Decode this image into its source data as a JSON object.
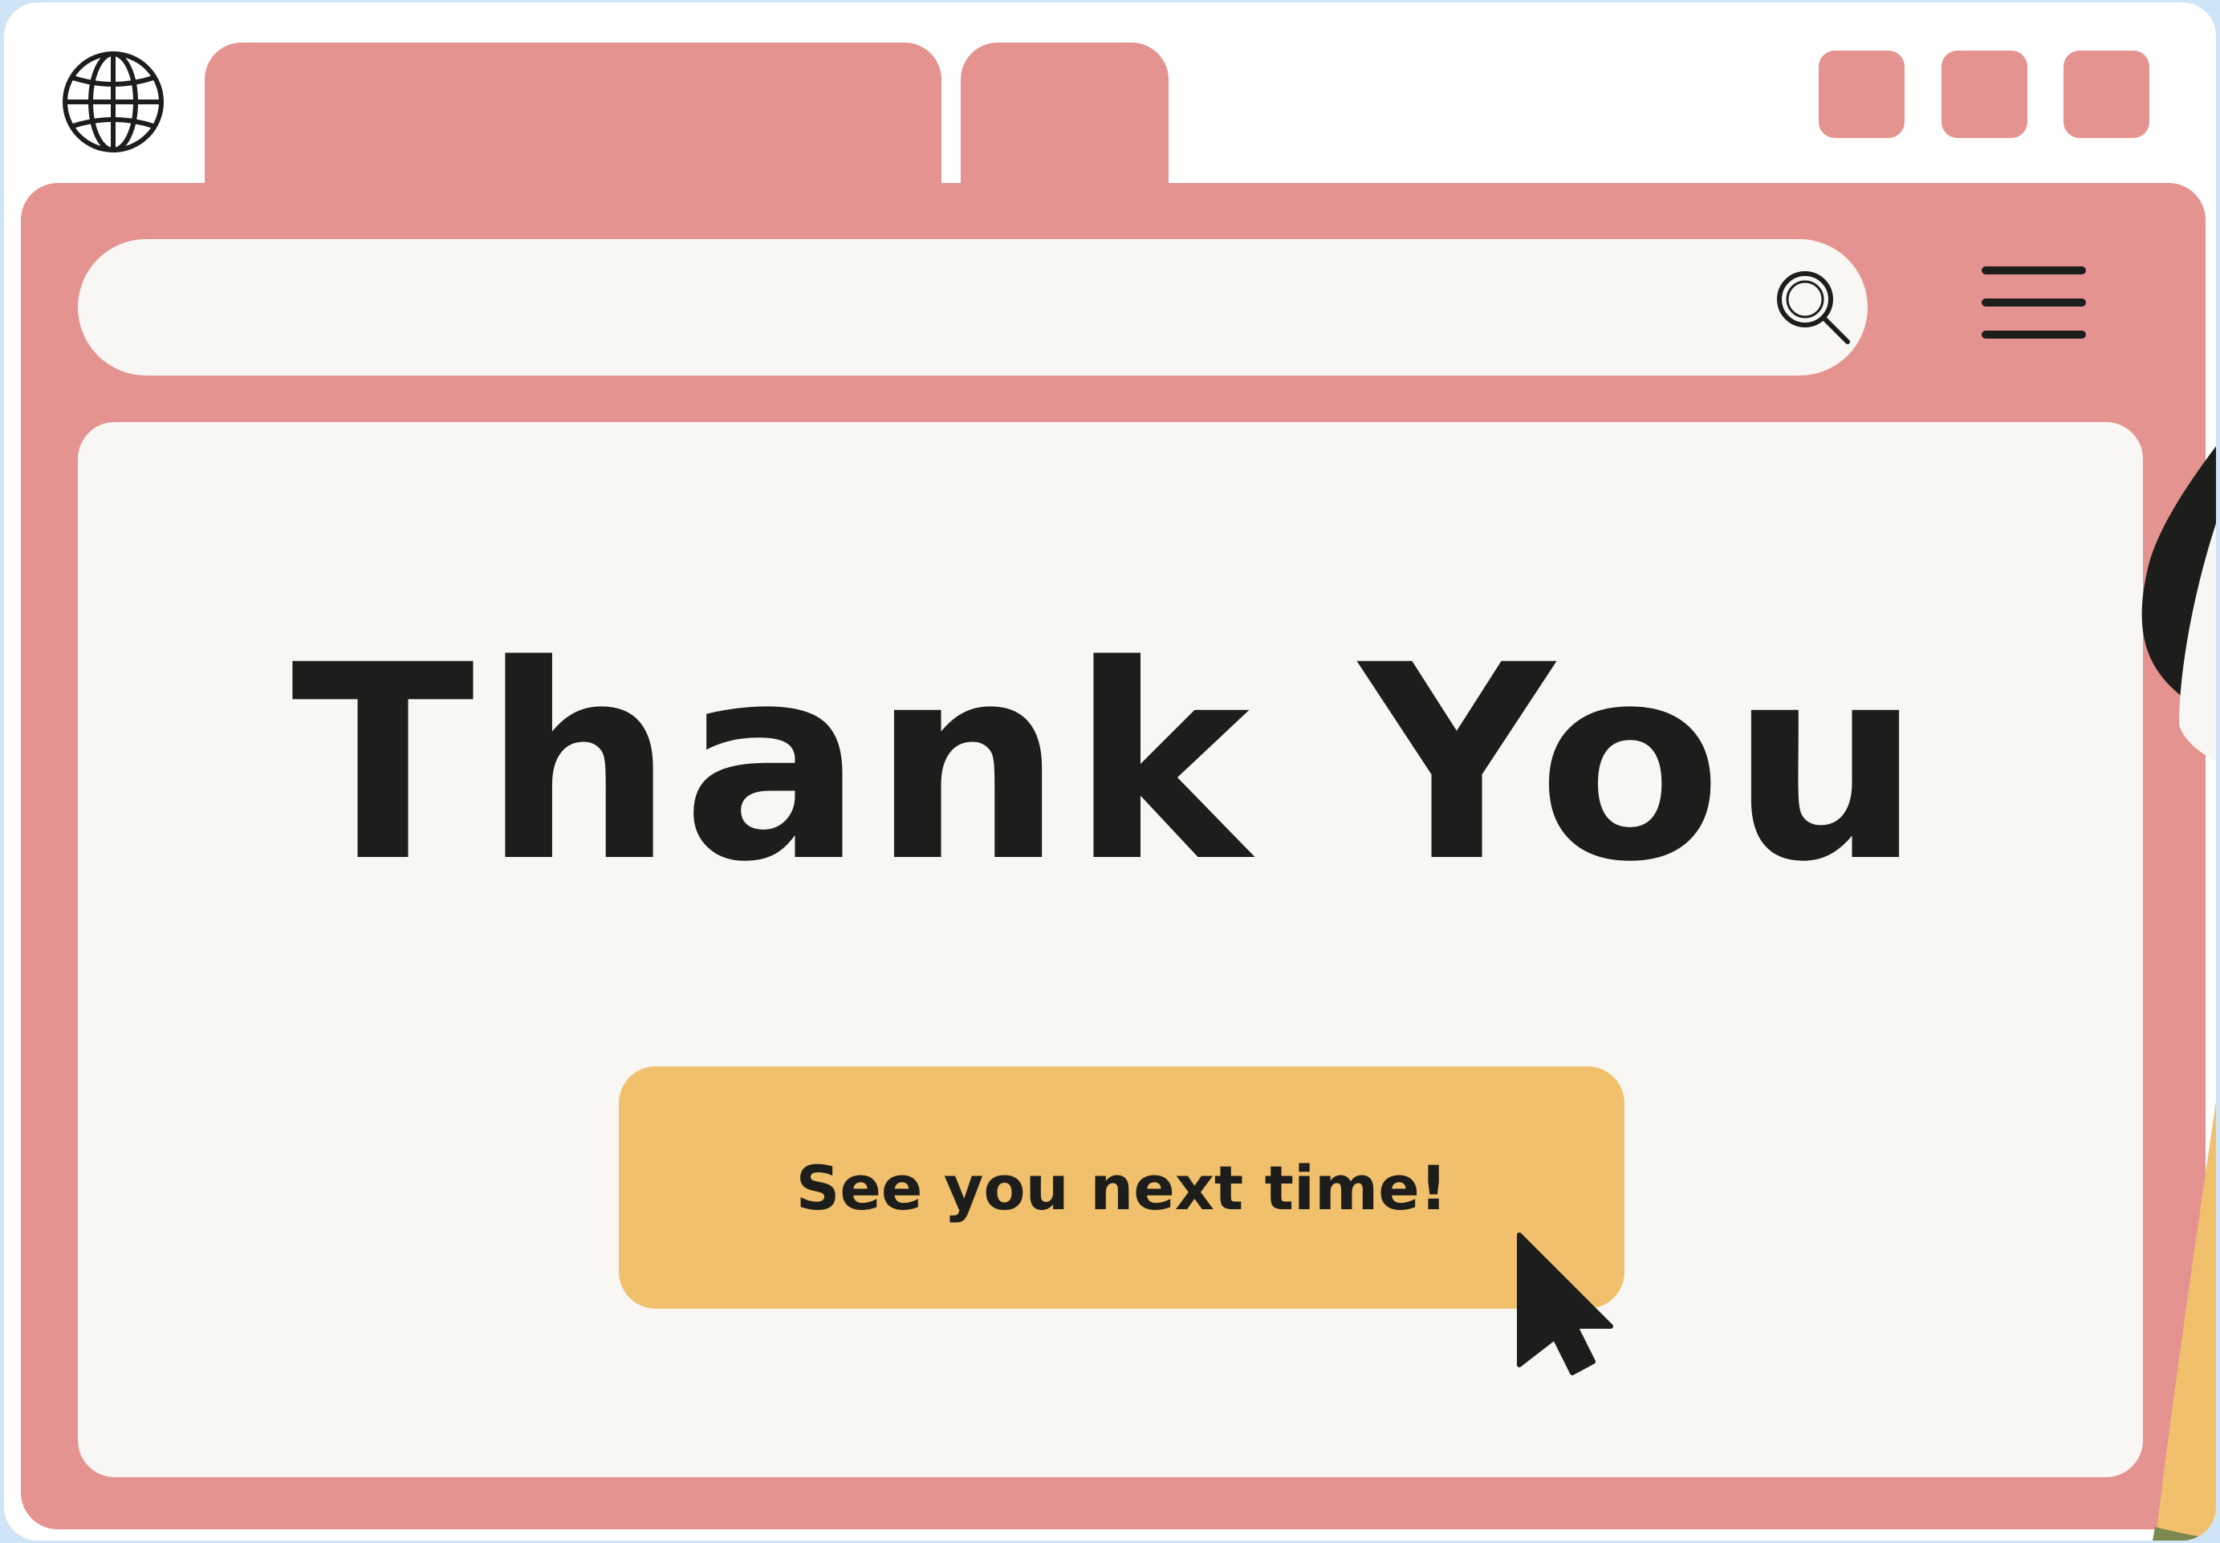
{
  "colors": {
    "frame": "#ffffff",
    "chrome": "#e49391",
    "panel": "#f8f7f3",
    "button": "#f0c06c",
    "ink": "#1d1d1b",
    "backdrop": "#cfe4f6"
  },
  "browser": {
    "site_icon": "globe-icon",
    "tabs": [
      {
        "label": "",
        "active": true
      },
      {
        "label": "",
        "active": false
      }
    ],
    "window_controls": [
      "window-button",
      "window-button",
      "window-button"
    ]
  },
  "toolbar": {
    "search": {
      "value": "",
      "placeholder": "",
      "icon": "search-icon"
    },
    "menu_icon": "hamburger-menu-icon"
  },
  "page": {
    "title": "Thank You",
    "cta_label": "See you next time!"
  }
}
